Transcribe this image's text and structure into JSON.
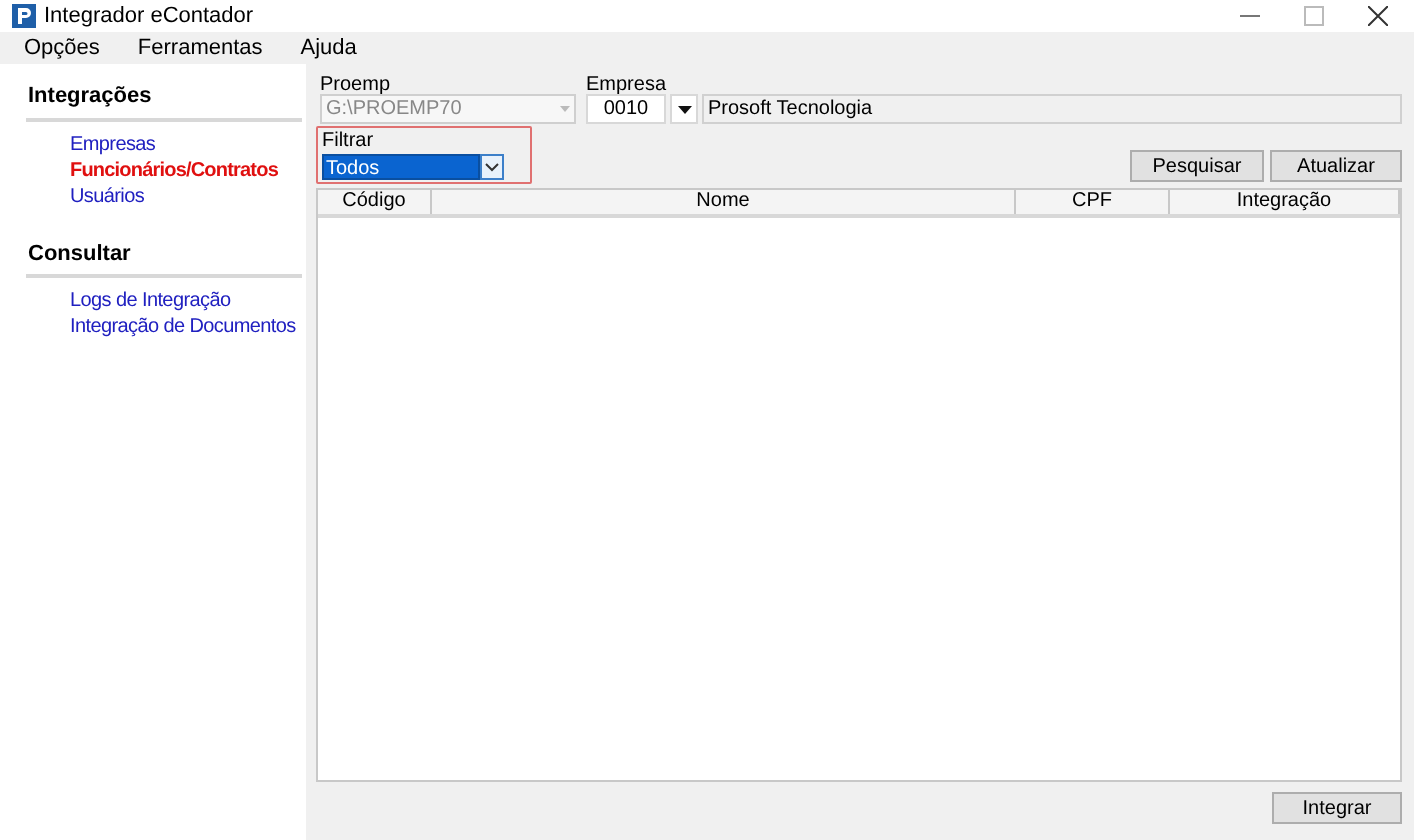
{
  "window": {
    "title": "Integrador eContador"
  },
  "menu": [
    "Opções",
    "Ferramentas",
    "Ajuda"
  ],
  "sidebar": {
    "sections": [
      {
        "title": "Integrações",
        "items": [
          {
            "label": "Empresas",
            "selected": false
          },
          {
            "label": "Funcionários/Contratos",
            "selected": true
          },
          {
            "label": "Usuários",
            "selected": false
          }
        ]
      },
      {
        "title": "Consultar",
        "items": [
          {
            "label": "Logs de Integração",
            "selected": false
          },
          {
            "label": "Integração de Documentos",
            "selected": false
          }
        ]
      }
    ]
  },
  "proemp": {
    "label": "Proemp",
    "value": "G:\\PROEMP70",
    "disabled": true
  },
  "empresa": {
    "label": "Empresa",
    "code": "0010",
    "name": "Prosoft Tecnologia"
  },
  "filter": {
    "label": "Filtrar",
    "value": "Todos"
  },
  "buttons": {
    "search": "Pesquisar",
    "refresh": "Atualizar",
    "integrate": "Integrar"
  },
  "table": {
    "columns": [
      "Código",
      "Nome",
      "CPF",
      "Integração"
    ]
  }
}
